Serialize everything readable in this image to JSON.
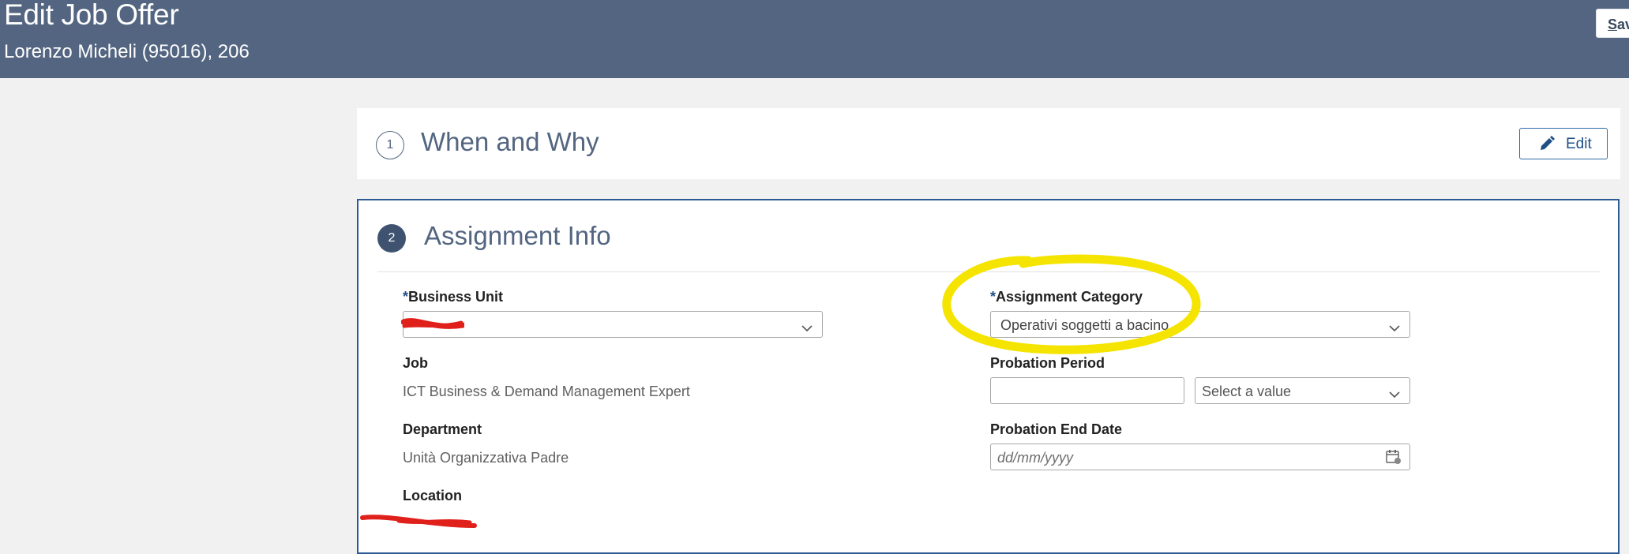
{
  "header": {
    "title": "Edit Job Offer",
    "subtitle": "Lorenzo Micheli (95016), 206",
    "save_label": "Sav",
    "save_mnemonic": "S"
  },
  "section1": {
    "number": "1",
    "title": "When and Why",
    "edit_label": "Edit"
  },
  "section2": {
    "number": "2",
    "title": "Assignment Info",
    "required_marker": "*",
    "business_unit": {
      "label": "Business Unit",
      "value": ""
    },
    "job": {
      "label": "Job",
      "value": "ICT Business & Demand Management Expert"
    },
    "department": {
      "label": "Department",
      "value": "Unità Organizzativa Padre"
    },
    "location": {
      "label": "Location",
      "value": ""
    },
    "assignment_category": {
      "label": "Assignment Category",
      "value": "Operativi soggetti a bacino"
    },
    "probation_period": {
      "label": "Probation Period",
      "value": "",
      "unit_placeholder": "Select a value"
    },
    "probation_end_date": {
      "label": "Probation End Date",
      "placeholder": "dd/mm/yyyy"
    }
  },
  "colors": {
    "header_bg": "#536580",
    "accent": "#2d5a95",
    "highlight": "#f5e400",
    "redaction": "#e0201a"
  },
  "icons": [
    "pencil-icon",
    "chevron-down-icon",
    "calendar-icon"
  ]
}
